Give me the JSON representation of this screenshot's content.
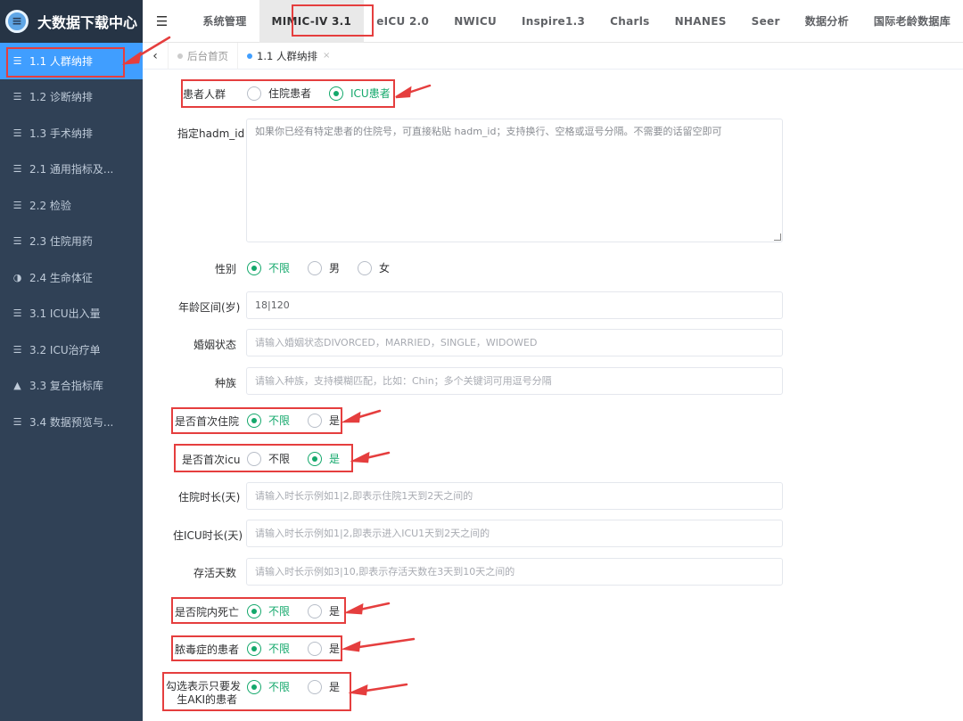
{
  "brand": {
    "title": "大数据下载中心",
    "logo_glyph": "≡",
    "icon": "logo-icon"
  },
  "sidebar": {
    "items": [
      {
        "label": "1.1 人群纳排",
        "icon": "list-icon",
        "glyph": "☰",
        "active": true
      },
      {
        "label": "1.2 诊断纳排",
        "icon": "list-icon",
        "glyph": "☰"
      },
      {
        "label": "1.3 手术纳排",
        "icon": "list-icon",
        "glyph": "☰"
      },
      {
        "label": "2.1 通用指标及...",
        "icon": "list-icon",
        "glyph": "☰"
      },
      {
        "label": "2.2 检验",
        "icon": "list-icon",
        "glyph": "☰"
      },
      {
        "label": "2.3 住院用药",
        "icon": "list-icon",
        "glyph": "☰"
      },
      {
        "label": "2.4 生命体征",
        "icon": "half-circle-icon",
        "glyph": "◑"
      },
      {
        "label": "3.1 ICU出入量",
        "icon": "list-icon",
        "glyph": "☰"
      },
      {
        "label": "3.2 ICU治疗单",
        "icon": "list-icon",
        "glyph": "☰"
      },
      {
        "label": "3.3 复合指标库",
        "icon": "flask-icon",
        "glyph": "▲"
      },
      {
        "label": "3.4 数据预览与...",
        "icon": "list-icon",
        "glyph": "☰"
      }
    ]
  },
  "topnav": {
    "menu_glyph": "☰",
    "items": [
      {
        "label": "系统管理"
      },
      {
        "label": "MIMIC-IV 3.1",
        "active": true
      },
      {
        "label": "eICU 2.0"
      },
      {
        "label": "NWICU"
      },
      {
        "label": "Inspire1.3"
      },
      {
        "label": "Charls"
      },
      {
        "label": "NHANES"
      },
      {
        "label": "Seer"
      },
      {
        "label": "数据分析"
      },
      {
        "label": "国际老龄数据库"
      }
    ]
  },
  "tags": {
    "back_glyph": "‹",
    "items": [
      {
        "label": "后台首页"
      },
      {
        "label": "1.1 人群纳排",
        "active": true,
        "close_glyph": "×"
      }
    ]
  },
  "form": {
    "population": {
      "label": "患者人群",
      "options": [
        "住院患者",
        "ICU患者"
      ],
      "selected": 1
    },
    "hadm": {
      "label": "指定hadm_id",
      "value": "",
      "placeholder": "如果你已经有特定患者的住院号，可直接粘贴 hadm_id；支持换行、空格或逗号分隔。不需要的话留空即可"
    },
    "gender": {
      "label": "性别",
      "options": [
        "不限",
        "男",
        "女"
      ],
      "selected": 0
    },
    "age": {
      "label": "年龄区间(岁)",
      "value": "18|120",
      "placeholder": ""
    },
    "marital": {
      "label": "婚姻状态",
      "value": "",
      "placeholder": "请输入婚姻状态DIVORCED，MARRIED，SINGLE，WIDOWED"
    },
    "race": {
      "label": "种族",
      "value": "",
      "placeholder": "请输入种族，支持模糊匹配，比如：Chin；多个关键词可用逗号分隔"
    },
    "first_hosp": {
      "label": "是否首次住院",
      "options": [
        "不限",
        "是"
      ],
      "selected": 0
    },
    "first_icu": {
      "label": "是否首次icu",
      "options": [
        "不限",
        "是"
      ],
      "selected": 1
    },
    "hosp_los": {
      "label": "住院时长(天)",
      "value": "",
      "placeholder": "请输入时长示例如1|2,即表示住院1天到2天之间的"
    },
    "icu_los": {
      "label": "住ICU时长(天)",
      "value": "",
      "placeholder": "请输入时长示例如1|2,即表示进入ICU1天到2天之间的"
    },
    "survival": {
      "label": "存活天数",
      "value": "",
      "placeholder": "请输入时长示例如3|10,即表示存活天数在3天到10天之间的"
    },
    "hosp_death": {
      "label": "是否院内死亡",
      "options": [
        "不限",
        "是"
      ],
      "selected": 0
    },
    "sepsis": {
      "label": "脓毒症的患者",
      "options": [
        "不限",
        "是"
      ],
      "selected": 0
    },
    "aki": {
      "label_line1": "勾选表示只要发",
      "label_line2": "生AKI的患者",
      "options": [
        "不限",
        "是"
      ],
      "selected": 0
    }
  },
  "colors": {
    "sidebar_bg": "#304156",
    "active_blue": "#409eff",
    "radio_green": "#13a86b",
    "annotation_red": "#e53e3e"
  }
}
